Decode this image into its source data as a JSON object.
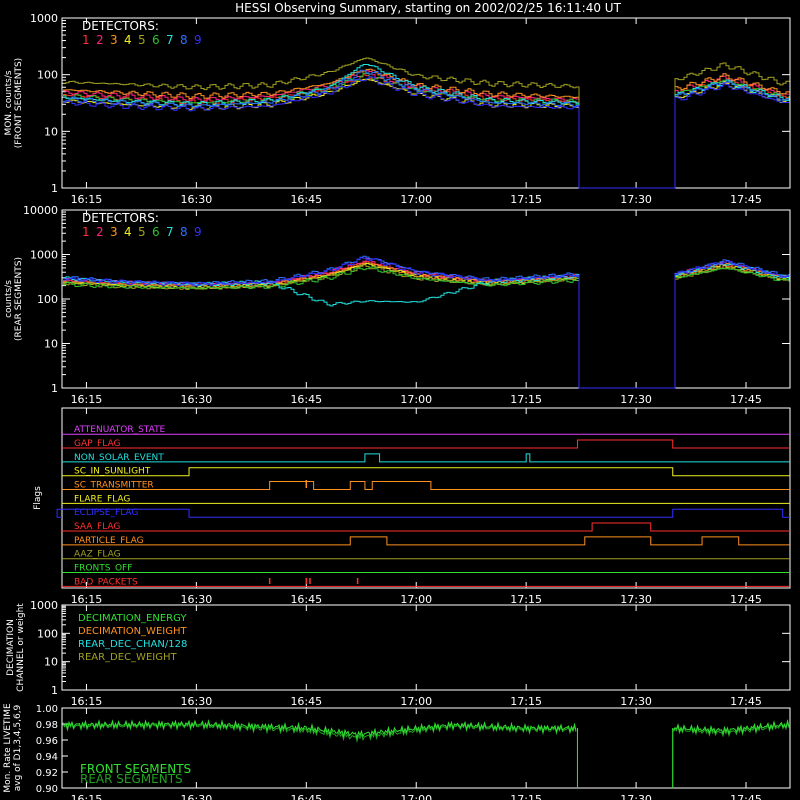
{
  "title": "HESSI Observing Summary, starting on 2002/02/25 16:11:40 UT",
  "colors": {
    "d1": "#ff3030",
    "d2": "#ff2080",
    "d3": "#ff9020",
    "d4": "#f0f020",
    "d5": "#a0a020",
    "d6": "#30c030",
    "d7": "#20e0e0",
    "d8": "#3070ff",
    "d9": "#3030ff",
    "white": "#ffffff",
    "magenta": "#e040ff",
    "green": "#30e030",
    "olive": "#909030",
    "yellowgreen": "#b0c020"
  },
  "time_ticks": [
    "16:15",
    "16:30",
    "16:45",
    "17:00",
    "17:15",
    "17:30",
    "17:45"
  ],
  "chart_data": [
    {
      "type": "line",
      "panel": "front",
      "ylabel": "MON. counts/s (FRONT SEGMENTS)",
      "ylog": true,
      "ylim": [
        1,
        1000
      ],
      "ytick_labels": [
        "1",
        "10",
        "100",
        "1000"
      ],
      "legend_title": "DETECTORS:",
      "legend_items": [
        "1",
        "2",
        "3",
        "4",
        "5",
        "6",
        "7",
        "8",
        "9"
      ],
      "x": [
        "16:11",
        "16:20",
        "16:30",
        "16:40",
        "16:48",
        "16:53",
        "17:00",
        "17:10",
        "17:22",
        "17:23",
        "17:35",
        "17:42",
        "17:50"
      ],
      "gap": [
        "17:22",
        "17:35"
      ],
      "series": [
        {
          "values": [
            45,
            38,
            33,
            38,
            55,
            95,
            55,
            38,
            33,
            1,
            45,
            80,
            40
          ]
        },
        {
          "values": [
            50,
            42,
            36,
            42,
            65,
            110,
            60,
            42,
            36,
            1,
            50,
            90,
            45
          ]
        },
        {
          "values": [
            55,
            48,
            42,
            46,
            70,
            125,
            65,
            46,
            40,
            1,
            55,
            95,
            48
          ]
        },
        {
          "values": [
            35,
            30,
            26,
            30,
            48,
            85,
            45,
            30,
            28,
            1,
            38,
            70,
            35
          ]
        },
        {
          "values": [
            75,
            68,
            60,
            66,
            110,
            200,
            95,
            70,
            62,
            1,
            80,
            150,
            70
          ]
        },
        {
          "values": [
            42,
            36,
            32,
            36,
            58,
            100,
            52,
            36,
            33,
            1,
            45,
            80,
            40
          ]
        },
        {
          "values": [
            40,
            34,
            30,
            35,
            60,
            160,
            60,
            35,
            32,
            1,
            42,
            75,
            38
          ]
        },
        {
          "values": [
            38,
            32,
            28,
            33,
            55,
            120,
            55,
            32,
            30,
            1,
            40,
            75,
            36
          ]
        },
        {
          "values": [
            33,
            28,
            25,
            28,
            48,
            90,
            45,
            28,
            26,
            1,
            35,
            65,
            32
          ]
        }
      ]
    },
    {
      "type": "line",
      "panel": "rear",
      "ylabel": "counts/s (REAR SEGMENTS)",
      "ylog": true,
      "ylim": [
        1,
        10000
      ],
      "ytick_labels": [
        "1",
        "10",
        "100",
        "1000",
        "10000"
      ],
      "legend_title": "DETECTORS:",
      "legend_items": [
        "1",
        "2",
        "3",
        "4",
        "5",
        "6",
        "7",
        "8",
        "9"
      ],
      "x": [
        "16:11",
        "16:20",
        "16:30",
        "16:40",
        "16:48",
        "16:53",
        "17:00",
        "17:10",
        "17:22",
        "17:23",
        "17:35",
        "17:42",
        "17:50"
      ],
      "gap": [
        "17:22",
        "17:35"
      ],
      "series": [
        {
          "values": [
            260,
            220,
            200,
            220,
            380,
            700,
            360,
            240,
            320,
            1,
            330,
            620,
            300
          ]
        },
        {
          "values": [
            280,
            230,
            210,
            230,
            400,
            760,
            380,
            250,
            340,
            1,
            350,
            660,
            320
          ]
        },
        {
          "values": [
            250,
            210,
            190,
            210,
            360,
            650,
            340,
            230,
            300,
            1,
            320,
            580,
            290
          ]
        },
        {
          "values": [
            240,
            200,
            185,
            200,
            340,
            620,
            330,
            220,
            290,
            1,
            310,
            560,
            280
          ]
        },
        {
          "values": [
            230,
            195,
            180,
            195,
            320,
            560,
            300,
            210,
            280,
            1,
            300,
            520,
            270
          ]
        },
        {
          "values": [
            220,
            190,
            175,
            190,
            300,
            520,
            290,
            205,
            270,
            1,
            290,
            500,
            260
          ]
        },
        {
          "values": [
            300,
            240,
            215,
            235,
            75,
            90,
            85,
            250,
            330,
            1,
            340,
            640,
            310
          ]
        },
        {
          "values": [
            310,
            250,
            225,
            250,
            450,
            900,
            420,
            270,
            360,
            1,
            360,
            720,
            330
          ]
        },
        {
          "values": [
            290,
            240,
            215,
            240,
            430,
            850,
            400,
            260,
            350,
            1,
            350,
            700,
            320
          ]
        }
      ]
    }
  ],
  "flags": [
    {
      "label": "ATTENUATOR_STATE",
      "color": "#e040ff",
      "on": []
    },
    {
      "label": "GAP_FLAG",
      "color": "#ff3030",
      "on": [
        [
          "17:22",
          "17:35"
        ]
      ]
    },
    {
      "label": "NON_SOLAR_EVENT",
      "color": "#20e0e0",
      "on": [
        [
          "16:53",
          "16:55"
        ],
        [
          "17:15",
          "17:15.5"
        ]
      ]
    },
    {
      "label": "SC_IN_SUNLIGHT",
      "color": "#f0f020",
      "on": [
        [
          "16:29",
          "17:35"
        ]
      ]
    },
    {
      "label": "SC_TRANSMITTER",
      "color": "#ff9020",
      "on": [
        [
          "16:40",
          "16:46"
        ],
        [
          "16:51",
          "16:53"
        ],
        [
          "16:54",
          "17:02"
        ]
      ]
    },
    {
      "label": "FLARE_FLAG",
      "color": "#f0f020",
      "on": []
    },
    {
      "label": "ECLIPSE_FLAG",
      "color": "#3030ff",
      "on": [
        [
          "16:11",
          "16:29"
        ],
        [
          "17:35",
          "17:50"
        ]
      ]
    },
    {
      "label": "SAA_FLAG",
      "color": "#ff3030",
      "on": [
        [
          "17:24",
          "17:32"
        ]
      ]
    },
    {
      "label": "PARTICLE_FLAG",
      "color": "#ff9020",
      "on": [
        [
          "16:51",
          "16:56"
        ],
        [
          "17:23",
          "17:32"
        ],
        [
          "17:39",
          "17:44"
        ]
      ]
    },
    {
      "label": "AAZ_FLAG",
      "color": "#a0a020",
      "on": []
    },
    {
      "label": "FRONTS_OFF",
      "color": "#30e030",
      "on": []
    },
    {
      "label": "BAD_PACKETS",
      "color": "#ff3030",
      "on": []
    }
  ],
  "flags_ylabel": "Flags",
  "decimation": {
    "ylabel": "DECIMATION CHANNEL or weight",
    "ylog": true,
    "ylim": [
      1,
      1000
    ],
    "ytick_labels": [
      "1",
      "10",
      "100",
      "1000"
    ],
    "legend": [
      {
        "label": "DECIMATION_ENERGY",
        "color": "#30e030"
      },
      {
        "label": "DECIMATION_WEIGHT",
        "color": "#ff9020"
      },
      {
        "label": "REAR_DEC_CHAN/128",
        "color": "#20e0e0"
      },
      {
        "label": "REAR_DEC_WEIGHT",
        "color": "#a0a020"
      }
    ]
  },
  "livetime": {
    "ylabel": "Mon. Rate LIVETIME avg of D1,3,4,5,6,9",
    "ylim": [
      0.9,
      1.0
    ],
    "ytick_labels": [
      "0.90",
      "0.92",
      "0.94",
      "0.96",
      "0.98",
      "1.00"
    ],
    "legend": [
      {
        "label": "FRONT SEGMENTS",
        "color": "#30e030"
      },
      {
        "label": "REAR SEGMENTS",
        "color": "#20a020"
      }
    ],
    "front": {
      "x": [
        "16:11",
        "16:30",
        "16:45",
        "16:52",
        "17:05",
        "17:15",
        "17:22",
        "17:35",
        "17:42",
        "17:50"
      ],
      "values": [
        0.979,
        0.98,
        0.975,
        0.967,
        0.979,
        0.975,
        0.975,
        0.975,
        0.972,
        0.979
      ]
    },
    "rear": {
      "x": [
        "16:11",
        "16:30",
        "16:45",
        "16:52",
        "17:05",
        "17:15",
        "17:22",
        "17:35",
        "17:42",
        "17:50"
      ],
      "values": [
        0.977,
        0.978,
        0.972,
        0.963,
        0.977,
        0.973,
        0.973,
        0.973,
        0.969,
        0.977
      ]
    }
  }
}
